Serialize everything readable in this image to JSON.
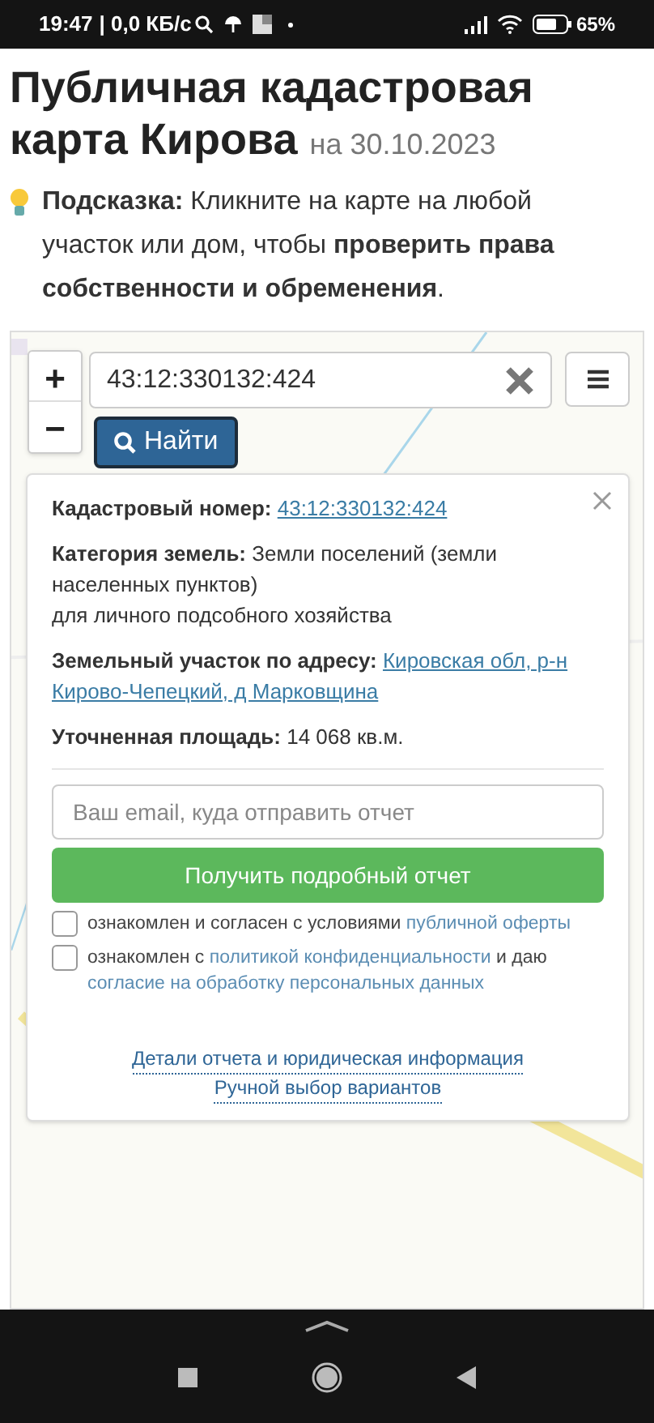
{
  "status_bar": {
    "time": "19:47",
    "speed": "| 0,0 КБ/с",
    "battery": "65%"
  },
  "title": "Публичная кадастровая карта Кирова",
  "title_date": "на 30.10.2023",
  "hint": "**Подсказка:** Кликните на карте на любой участок или дом, чтобы **проверить права собственности и обременения**.",
  "map": {
    "zoom_in": "+",
    "zoom_out": "−",
    "search_value": "43:12:330132:424",
    "find_button": "Найти",
    "popup": {
      "cadastral": {
        "label": "Кадастровый номер:",
        "link": "43:12:330132:424"
      },
      "category": {
        "label": "Категория земель:",
        "value": "Земли поселений (земли населенных пунктов)",
        "note": "для личного подсобного хозяйства"
      },
      "address": {
        "label": "Земельный участок по адресу:",
        "link_lines": [
          "Кировская обл, р-н",
          "Кирово-Чепецкий, д Марковщина"
        ]
      },
      "area": {
        "label": "Уточненная площадь:",
        "value": "14 068 кв.м."
      },
      "email_placeholder": "Ваш email, куда отправить отчет",
      "report_button": "Получить подробный отчет",
      "agreements": [
        {
          "checked": false,
          "parts": [
            {
              "kind": "text",
              "text": "ознакомлен и согласен с условиями"
            },
            {
              "kind": "link",
              "text": "публичной оферты"
            }
          ]
        },
        {
          "checked": false,
          "parts": [
            {
              "kind": "text",
              "text": "ознакомлен с"
            },
            {
              "kind": "link",
              "text": "политикой конфиденциальности"
            },
            {
              "kind": "text",
              "text": "и даю"
            },
            {
              "kind": "link",
              "text": "согласие на обработку персональных данных"
            }
          ]
        }
      ],
      "links": [
        "Детали отчета и юридическая информация",
        "Ручной выбор вариантов"
      ]
    }
  }
}
